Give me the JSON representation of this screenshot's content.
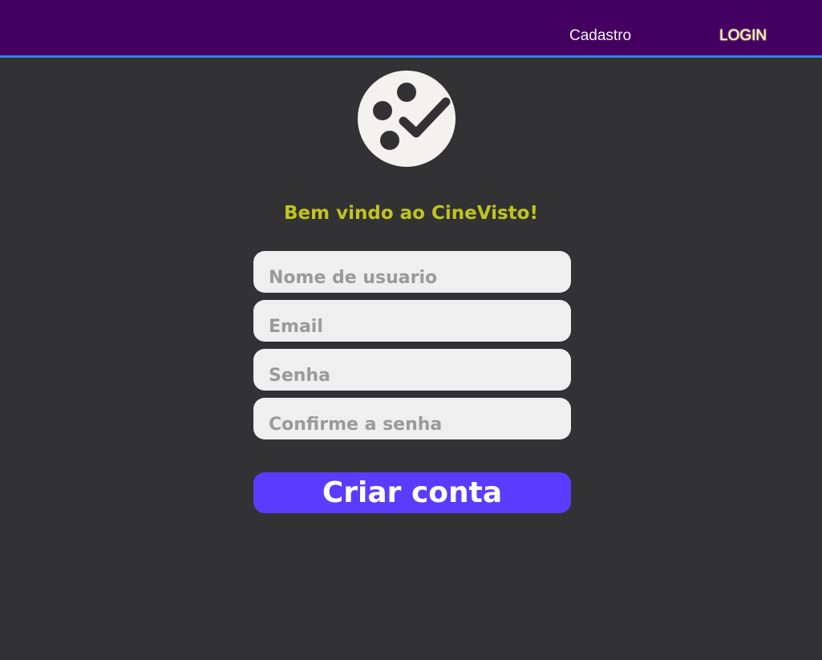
{
  "colors": {
    "topbar": "#440060",
    "topbar_border": "#2f86e6",
    "background": "#323234",
    "welcome_text": "#c1c41e",
    "field_bg": "#efefef",
    "placeholder": "#9a9a9a",
    "button": "#5b3cff",
    "logo": "#f3f2ee"
  },
  "nav": {
    "cadastro_label": "Cadastro",
    "login_label": "LOGIN"
  },
  "logo": {
    "icon": "film-reel-check-icon"
  },
  "form": {
    "welcome": "Bem vindo ao CineVisto!",
    "username_placeholder": "Nome de usuario",
    "email_placeholder": "Email",
    "password_placeholder": "Senha",
    "confirm_placeholder": "Confirme a senha",
    "submit_label": "Criar conta"
  }
}
